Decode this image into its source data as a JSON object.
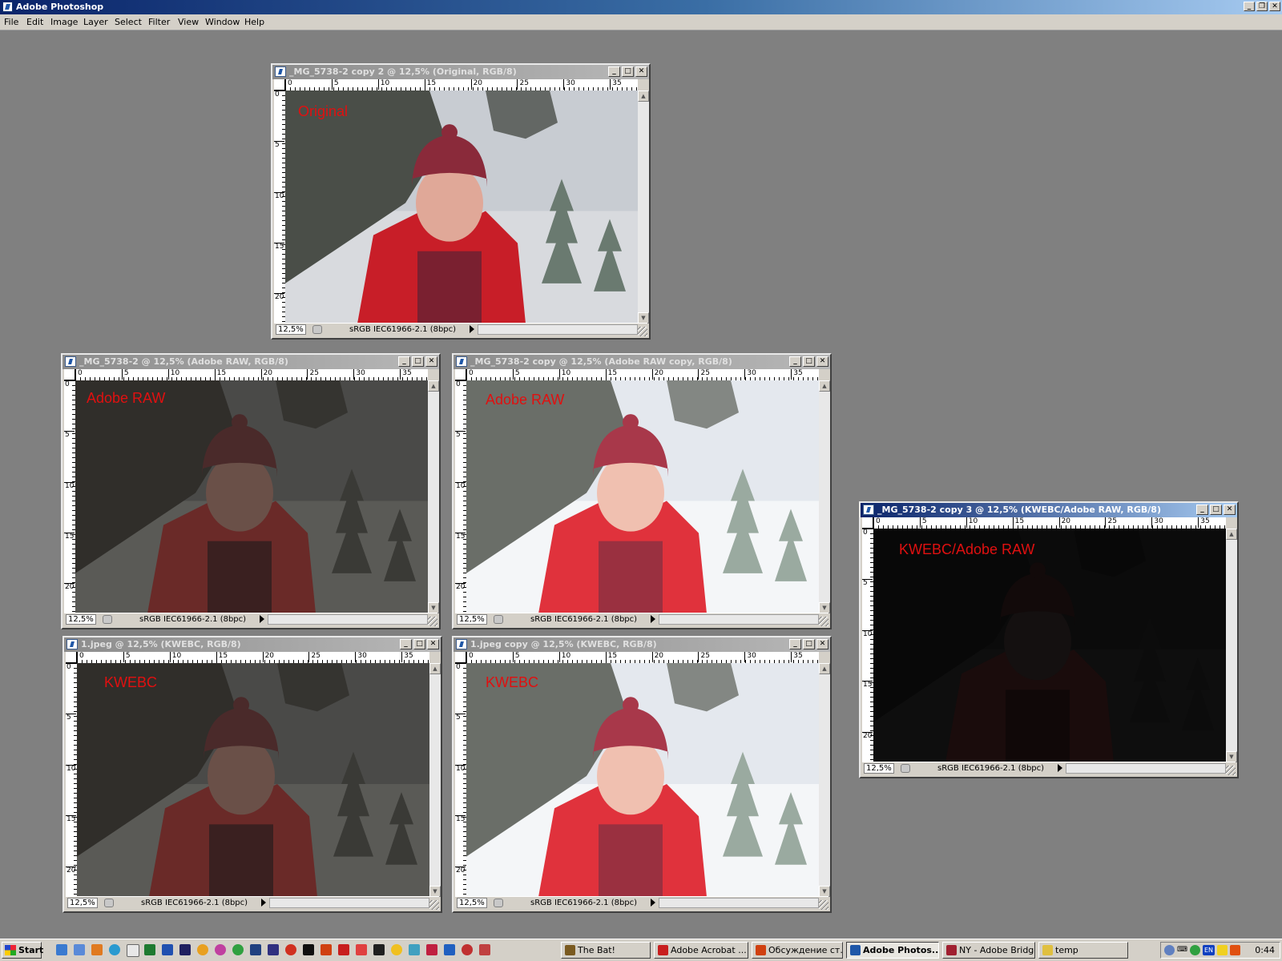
{
  "app": {
    "title": "Adobe Photoshop",
    "window_buttons": [
      "_",
      "❐",
      "✕"
    ]
  },
  "menu": [
    "File",
    "Edit",
    "Image",
    "Layer",
    "Select",
    "Filter",
    "View",
    "Window",
    "Help"
  ],
  "ruler_ticks_h": [
    "0",
    "5",
    "10",
    "15",
    "20",
    "25",
    "30",
    "35"
  ],
  "ruler_ticks_v": [
    "0",
    "5",
    "10",
    "15",
    "20"
  ],
  "documents": [
    {
      "id": "doc-original",
      "title": "_MG_5738-2 copy 2 @ 12,5% (Original, RGB/8)",
      "label": "Original",
      "zoom": "12,5%",
      "profile": "sRGB IEC61966-2.1 (8bpc)",
      "active": false,
      "brightness": "normal"
    },
    {
      "id": "doc-adobe-raw-dark",
      "title": "_MG_5738-2 @ 12,5% (Adobe RAW, RGB/8)",
      "label": "Adobe RAW",
      "zoom": "12,5%",
      "profile": "sRGB IEC61966-2.1 (8bpc)",
      "active": false,
      "brightness": "dark"
    },
    {
      "id": "doc-adobe-raw-copy",
      "title": "_MG_5738-2 copy @ 12,5% (Adobe RAW copy, RGB/8)",
      "label": "Adobe RAW",
      "zoom": "12,5%",
      "profile": "sRGB IEC61966-2.1 (8bpc)",
      "active": false,
      "brightness": "bright"
    },
    {
      "id": "doc-kwebc-dark",
      "title": "1.jpeg @ 12,5% (KWEBC, RGB/8)",
      "label": "KWEBC",
      "zoom": "12,5%",
      "profile": "sRGB IEC61966-2.1 (8bpc)",
      "active": false,
      "brightness": "dark"
    },
    {
      "id": "doc-kwebc-copy",
      "title": "1.jpeg copy @ 12,5% (KWEBC, RGB/8)",
      "label": "KWEBC",
      "zoom": "12,5%",
      "profile": "sRGB IEC61966-2.1 (8bpc)",
      "active": false,
      "brightness": "bright"
    },
    {
      "id": "doc-kwebc-adobe-raw",
      "title": "_MG_5738-2 copy 3 @ 12,5% (KWEBC/Adobe RAW, RGB/8)",
      "label": "KWEBC/Adobe RAW",
      "zoom": "12,5%",
      "profile": "sRGB IEC61966-2.1 (8bpc)",
      "active": true,
      "brightness": "black"
    }
  ],
  "taskbar": {
    "start_label": "Start",
    "tasks": [
      {
        "label": "The Bat!",
        "active": false,
        "icon_color": "#7a5a20"
      },
      {
        "label": "Adobe Acrobat ...",
        "active": false,
        "icon_color": "#c81e1e"
      },
      {
        "label": "Обсуждение ст...",
        "active": false,
        "icon_color": "#d04010"
      },
      {
        "label": "Adobe Photos...",
        "active": true,
        "icon_color": "#1f57a8"
      },
      {
        "label": "NY - Adobe Bridge",
        "active": false,
        "icon_color": "#a02030"
      },
      {
        "label": "temp",
        "active": false,
        "icon_color": "#e0c040"
      }
    ],
    "tray_text": "EN",
    "clock": "0:44"
  },
  "colors": {
    "workspace": "#808080",
    "label_red": "#e01010",
    "active_title": "#0a246a"
  }
}
